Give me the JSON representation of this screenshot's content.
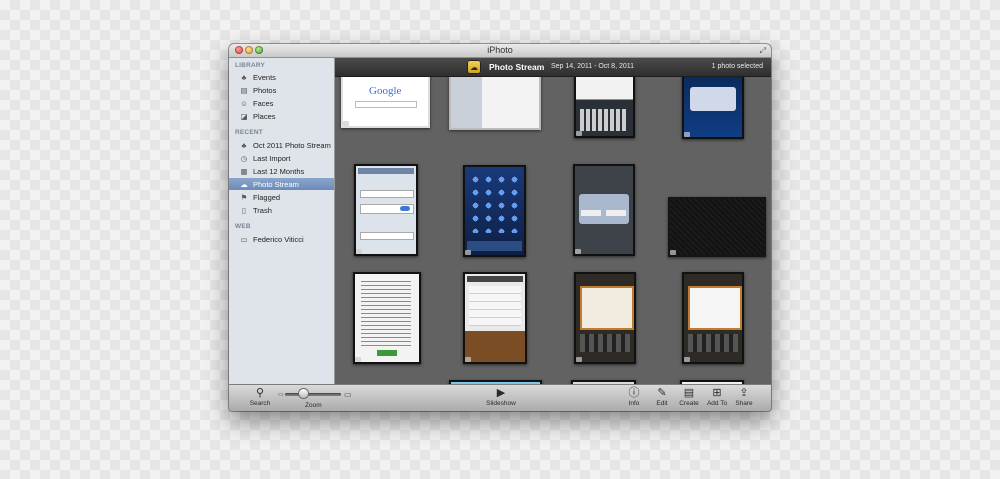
{
  "window": {
    "title": "iPhoto"
  },
  "sidebar": {
    "library_heading": "LIBRARY",
    "library_items": [
      {
        "label": "Events",
        "icon": "palm-tree-icon"
      },
      {
        "label": "Photos",
        "icon": "photos-icon"
      },
      {
        "label": "Faces",
        "icon": "faces-icon"
      },
      {
        "label": "Places",
        "icon": "places-icon"
      }
    ],
    "recent_heading": "RECENT",
    "recent_items": [
      {
        "label": "Oct 2011 Photo Stream",
        "icon": "palm-tree-icon"
      },
      {
        "label": "Last Import",
        "icon": "clock-icon"
      },
      {
        "label": "Last 12 Months",
        "icon": "calendar-icon"
      },
      {
        "label": "Photo Stream",
        "icon": "photo-stream-icon",
        "selected": true
      },
      {
        "label": "Flagged",
        "icon": "flag-icon"
      },
      {
        "label": "Trash",
        "icon": "trash-icon"
      }
    ],
    "web_heading": "WEB",
    "web_items": [
      {
        "label": "Federico Viticci",
        "icon": "web-gallery-icon"
      }
    ]
  },
  "header": {
    "title": "Photo Stream",
    "date_range": "Sep 14, 2011 - Oct 8, 2011",
    "selection": "1 photo selected"
  },
  "toolbar": {
    "search_label": "Search",
    "zoom_label": "Zoom",
    "zoom_level": 0.33,
    "slideshow_label": "Slideshow",
    "info_label": "Info",
    "edit_label": "Edit",
    "create_label": "Create",
    "add_to_label": "Add To",
    "share_label": "Share"
  },
  "colors": {
    "content_bg": "#626262",
    "sidebar_bg": "#dfe4ea",
    "selection": "#7594c3"
  }
}
